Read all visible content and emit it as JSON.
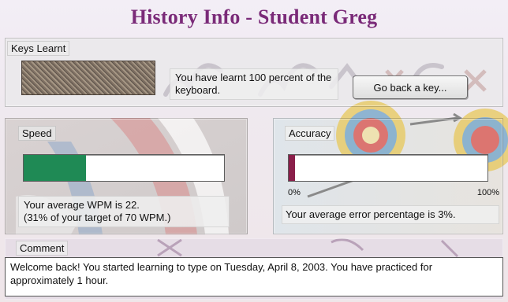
{
  "header": {
    "title": "History Info - Student Greg"
  },
  "keys_learnt": {
    "label": "Keys Learnt",
    "message": "You have learnt 100 percent of the keyboard.",
    "button_label": "Go back a key..."
  },
  "speed": {
    "label": "Speed",
    "progress_fraction": 0.31,
    "fill_color": "#1f8a55",
    "line1": "Your average WPM is 22.",
    "line2": "(31% of your target of 70 WPM.)"
  },
  "accuracy": {
    "label": "Accuracy",
    "error_fraction": 0.03,
    "fill_color": "#8a1f4a",
    "scale_min": "0%",
    "scale_max": "100%",
    "message": "Your average error percentage is 3%."
  },
  "comment": {
    "label": "Comment",
    "text": "Welcome back!  You started learning to type on Tuesday, April 8, 2003.  You have practiced for approximately 1 hour."
  },
  "colors": {
    "title": "#7a2a78",
    "speed_fill": "#1f8a55",
    "accuracy_fill": "#8a1f4a"
  }
}
